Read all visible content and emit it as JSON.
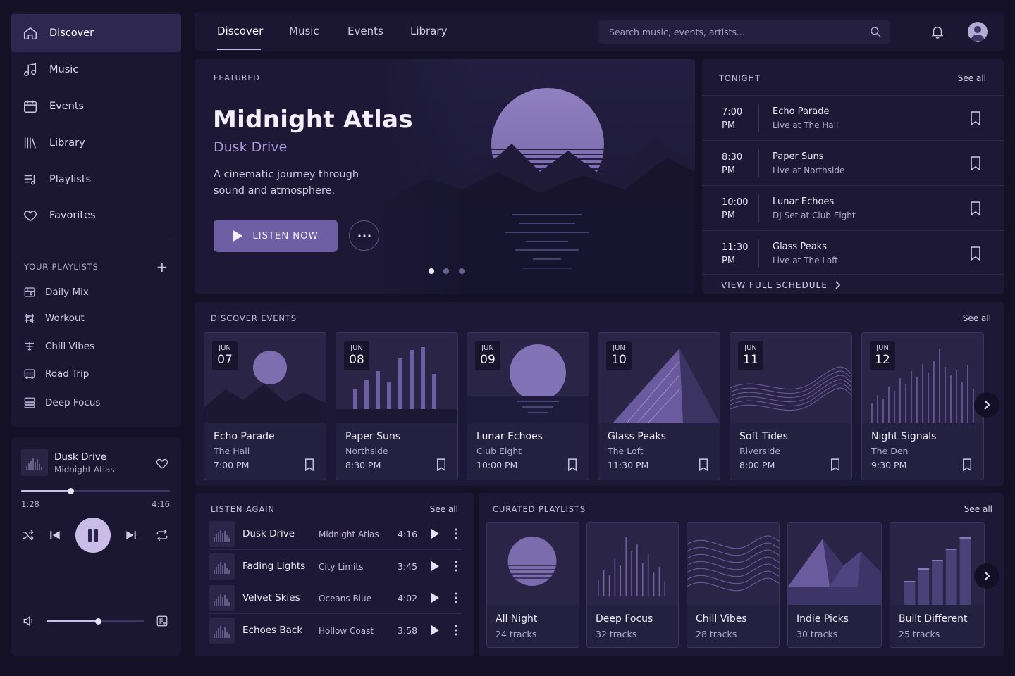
{
  "sidebar": {
    "nav": [
      {
        "label": "Discover",
        "icon": "home-icon"
      },
      {
        "label": "Music",
        "icon": "music-note-icon"
      },
      {
        "label": "Events",
        "icon": "calendar-icon"
      },
      {
        "label": "Library",
        "icon": "library-icon"
      },
      {
        "label": "Playlists",
        "icon": "playlist-icon"
      },
      {
        "label": "Favorites",
        "icon": "heart-icon"
      }
    ],
    "your_playlists_label": "YOUR PLAYLISTS",
    "add_icon": "+",
    "playlists": [
      "Daily Mix",
      "Workout",
      "Chill Vibes",
      "Road Trip",
      "Deep Focus"
    ]
  },
  "player": {
    "title": "Dusk Drive",
    "artist": "Midnight Atlas",
    "current_time": "1:28",
    "total_time": "4:16",
    "progress": 0.33,
    "volume": 0.52,
    "state": "playing"
  },
  "topbar": {
    "tabs": [
      "Discover",
      "Music",
      "Events",
      "Library"
    ],
    "active_tab": "Discover",
    "search_placeholder": "Search music, events, artists..."
  },
  "featured": {
    "label": "FEATURED",
    "title": "Midnight Atlas",
    "subtitle": "Dusk Drive",
    "description": "A cinematic journey through sound and atmosphere.",
    "cta": "LISTEN NOW",
    "slides": 3,
    "active_slide": 1
  },
  "tonight": {
    "label": "TONIGHT",
    "see_all": "See all",
    "items": [
      {
        "time": "7:00",
        "ampm": "PM",
        "name": "Echo Parade",
        "venue": "Live at The Hall"
      },
      {
        "time": "8:30",
        "ampm": "PM",
        "name": "Paper Suns",
        "venue": "Live at Northside"
      },
      {
        "time": "10:00",
        "ampm": "PM",
        "name": "Lunar Echoes",
        "venue": "DJ Set at Club Eight"
      },
      {
        "time": "11:30",
        "ampm": "PM",
        "name": "Glass Peaks",
        "venue": "Live at The Loft"
      }
    ],
    "full_schedule": "VIEW FULL SCHEDULE"
  },
  "events": {
    "label": "DISCOVER EVENTS",
    "see_all": "See all",
    "items": [
      {
        "month": "JUN",
        "day": "07",
        "name": "Echo Parade",
        "venue": "The Hall",
        "time": "7:00 PM"
      },
      {
        "month": "JUN",
        "day": "08",
        "name": "Paper Suns",
        "venue": "Northside",
        "time": "8:30 PM"
      },
      {
        "month": "JUN",
        "day": "09",
        "name": "Lunar Echoes",
        "venue": "Club Eight",
        "time": "10:00 PM"
      },
      {
        "month": "JUN",
        "day": "10",
        "name": "Glass Peaks",
        "venue": "The Loft",
        "time": "11:30 PM"
      },
      {
        "month": "JUN",
        "day": "11",
        "name": "Soft Tides",
        "venue": "Riverside",
        "time": "8:00 PM"
      },
      {
        "month": "JUN",
        "day": "12",
        "name": "Night Signals",
        "venue": "The Den",
        "time": "9:30 PM"
      }
    ]
  },
  "listen_again": {
    "label": "LISTEN AGAIN",
    "see_all": "See all",
    "items": [
      {
        "title": "Dusk Drive",
        "artist": "Midnight Atlas",
        "duration": "4:16"
      },
      {
        "title": "Fading Lights",
        "artist": "City Limits",
        "duration": "3:45"
      },
      {
        "title": "Velvet Skies",
        "artist": "Oceans Blue",
        "duration": "4:02"
      },
      {
        "title": "Echoes Back",
        "artist": "Hollow Coast",
        "duration": "3:58"
      }
    ]
  },
  "curated": {
    "label": "CURATED PLAYLISTS",
    "see_all": "See all",
    "items": [
      {
        "name": "All Night",
        "tracks": "24 tracks"
      },
      {
        "name": "Deep Focus",
        "tracks": "32 tracks"
      },
      {
        "name": "Chill Vibes",
        "tracks": "28 tracks"
      },
      {
        "name": "Indie Picks",
        "tracks": "30 tracks"
      },
      {
        "name": "Built Different",
        "tracks": "25 tracks"
      }
    ]
  },
  "colors": {
    "background": "#141126",
    "panel": "#1c1835",
    "accent": "#6e5ea3",
    "accent_light": "#c9bde8"
  }
}
